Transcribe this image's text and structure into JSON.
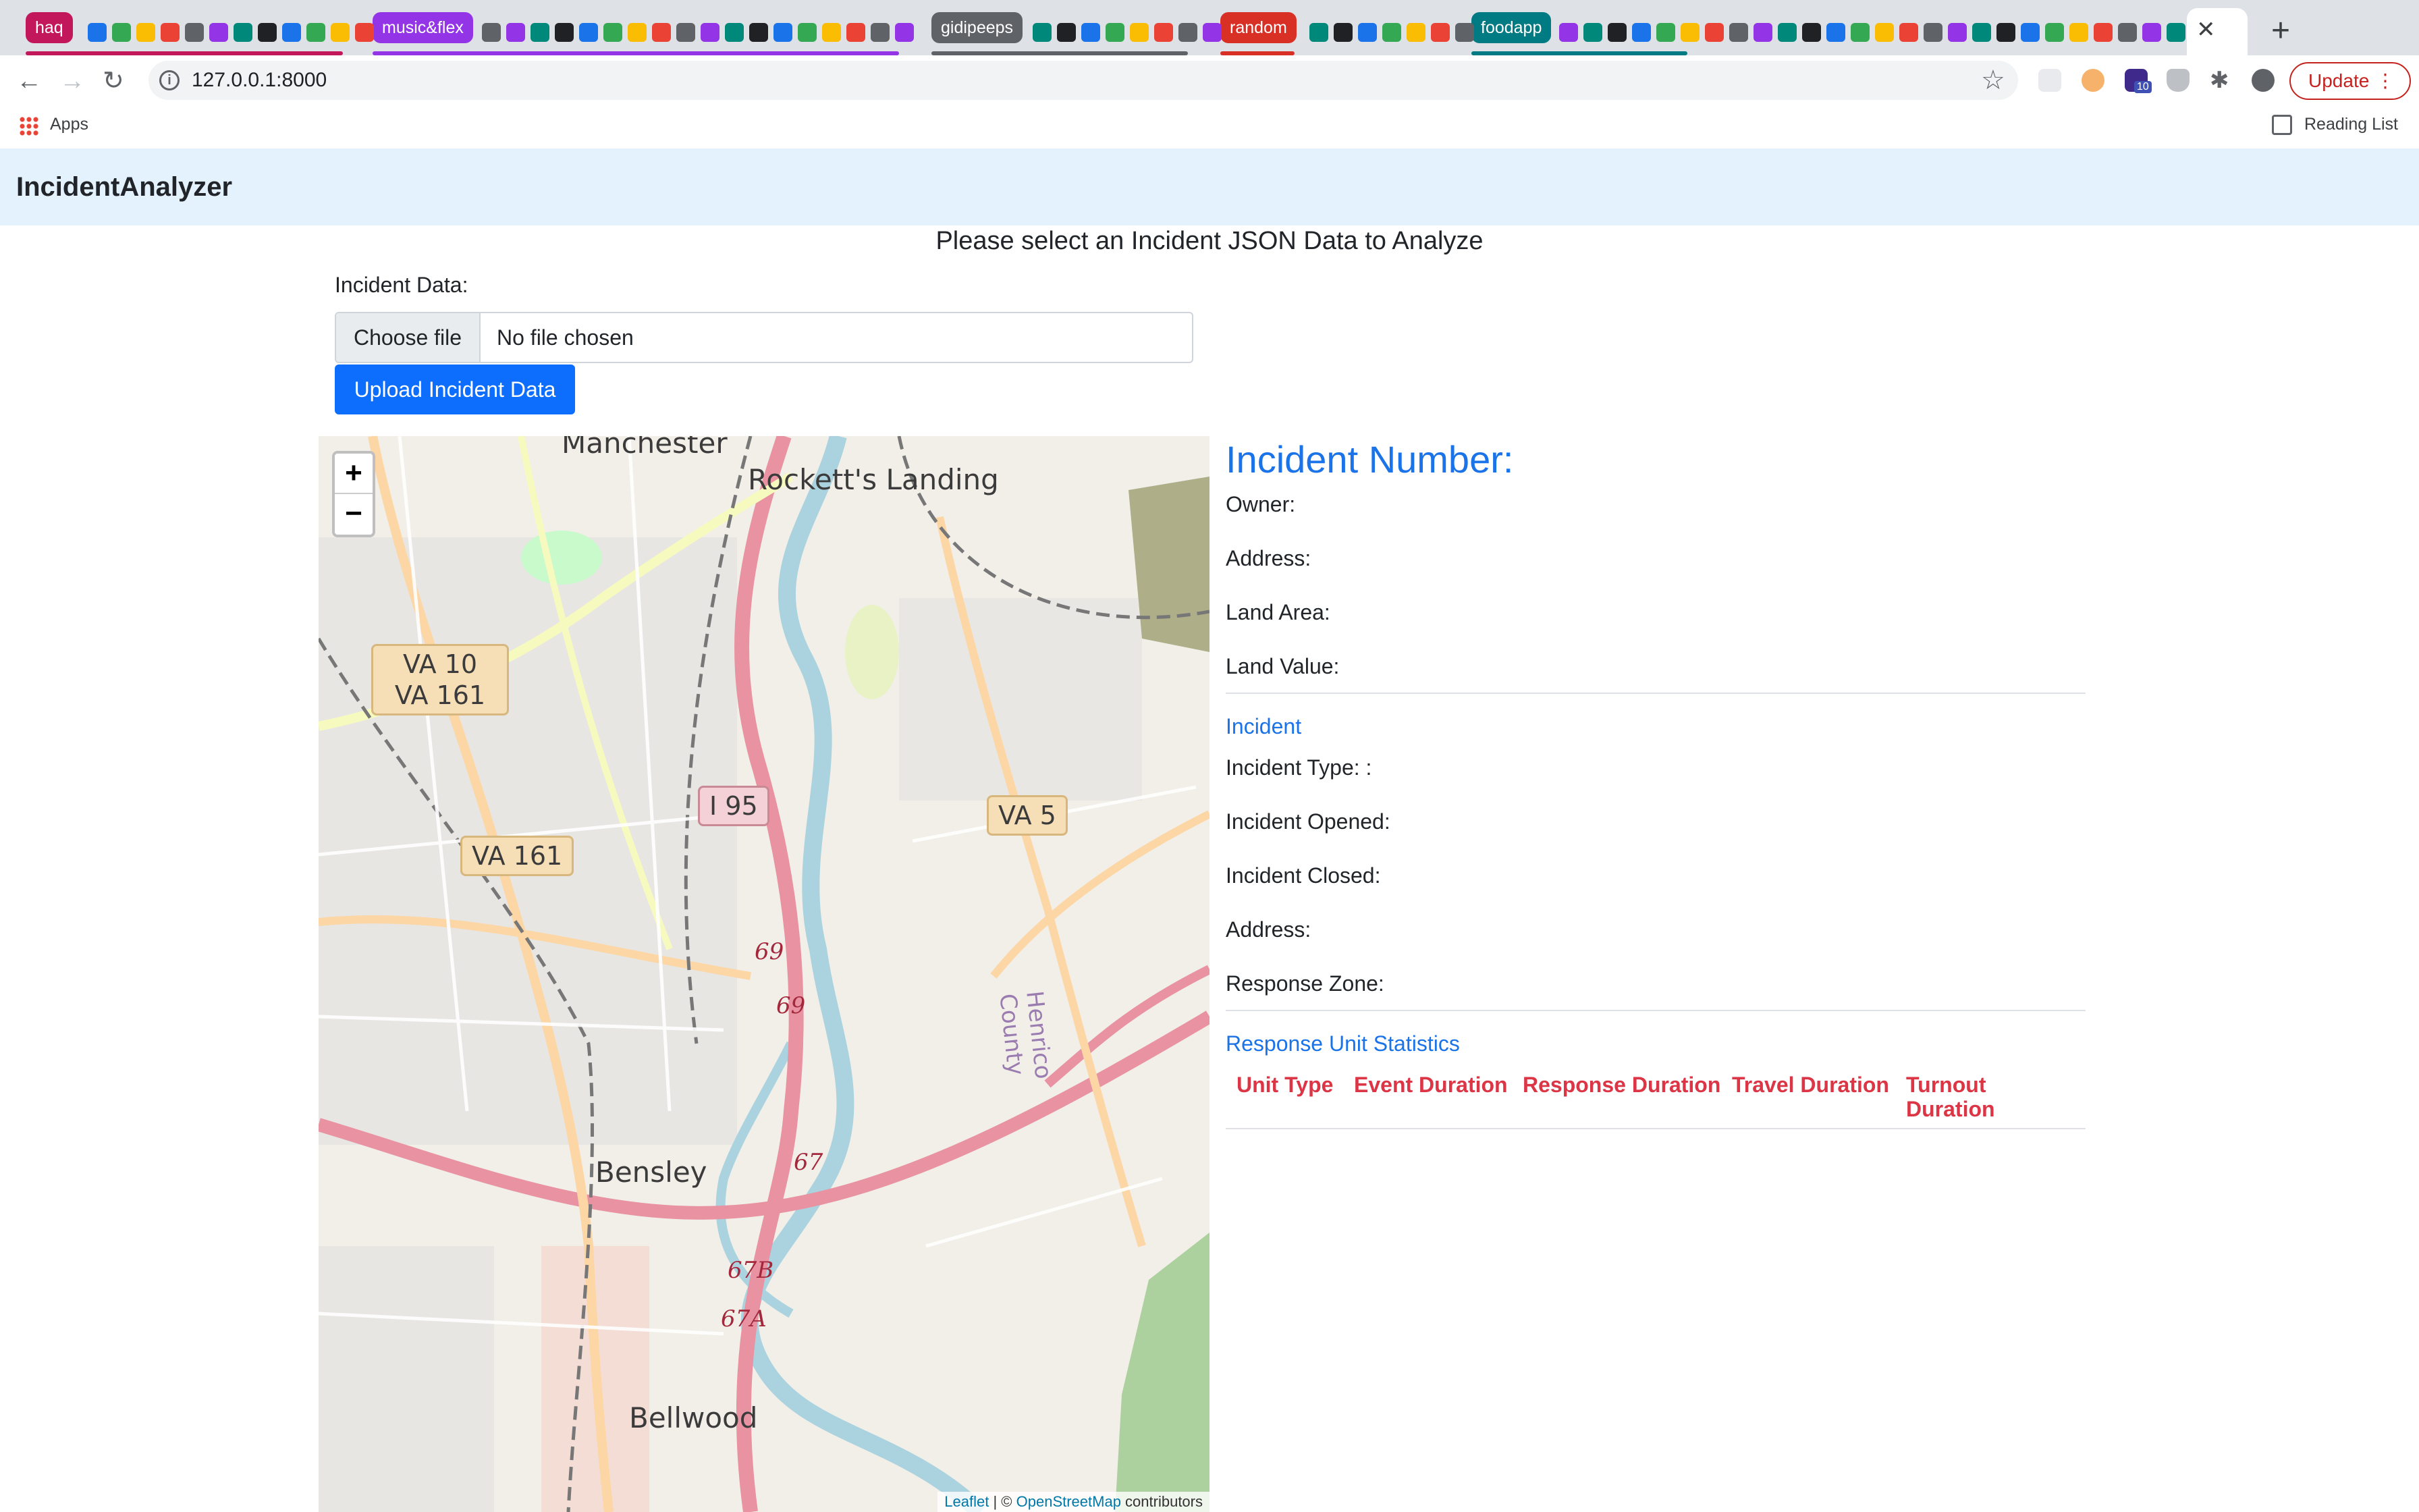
{
  "browser": {
    "tab_groups": [
      {
        "label": "haq",
        "color": "#c2185b"
      },
      {
        "label": "music&flex",
        "color": "#9334e6"
      },
      {
        "label": "gidipeeps",
        "color": "#5f6368"
      },
      {
        "label": "random",
        "color": "#d93025"
      },
      {
        "label": "foodapp",
        "color": "#007b83"
      }
    ],
    "url": "127.0.0.1:8000",
    "update_label": "Update",
    "bookmarks": {
      "apps_label": "Apps",
      "reading_list_label": "Reading List"
    },
    "extension_badge": "10"
  },
  "app": {
    "brand": "IncidentAnalyzer",
    "page_heading": "Please select an Incident JSON Data to Analyze",
    "upload": {
      "label": "Incident Data:",
      "choose_file": "Choose file",
      "no_file": "No file chosen",
      "button": "Upload Incident Data"
    }
  },
  "map": {
    "zoom_in": "+",
    "zoom_out": "−",
    "places": [
      "Manchester",
      "Rockett's Landing",
      "Bensley",
      "Bellwood",
      "Henrico County"
    ],
    "shields": [
      "VA 10",
      "VA 161",
      "VA 161",
      "I 95",
      "VA 5"
    ],
    "exits": [
      "69",
      "69",
      "67",
      "67B",
      "67A"
    ],
    "attribution": {
      "leaflet": "Leaflet",
      "sep": " | © ",
      "osm": "OpenStreetMap",
      "suffix": " contributors"
    }
  },
  "details": {
    "title": "Incident Number:",
    "property_fields": [
      "Owner:",
      "Address:",
      "Land Area:",
      "Land Value:"
    ],
    "incident_section": "Incident",
    "incident_fields": [
      "Incident Type: :",
      "Incident Opened:",
      "Incident Closed:",
      "Address:",
      "Response Zone:"
    ],
    "stats_section": "Response Unit Statistics",
    "table_headers": [
      "Unit Type",
      "Event Duration",
      "Response Duration",
      "Travel Duration",
      "Turnout Duration"
    ]
  },
  "colors": {
    "brand_blue": "#1a73e8",
    "primary_button": "#0d6efd",
    "header_red": "#dc3545",
    "navbar_bg": "#e3f2fd"
  }
}
